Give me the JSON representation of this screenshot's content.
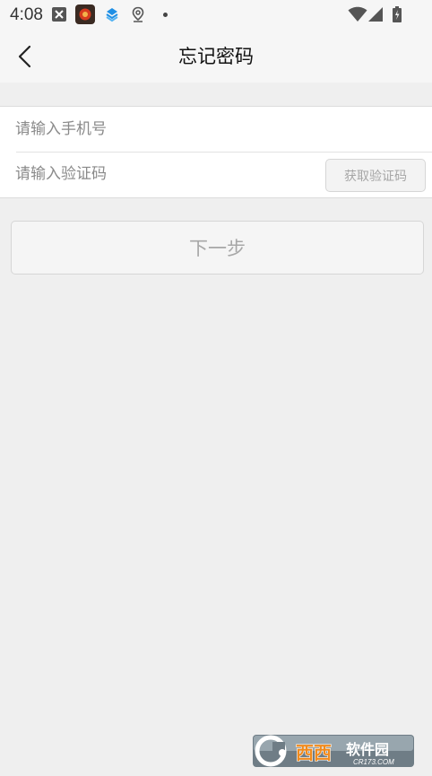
{
  "status_bar": {
    "time": "4:08",
    "icons": [
      "close-box-icon",
      "app-icon-red",
      "layers-icon",
      "location-pin-icon",
      "notification-dot",
      "wifi-icon",
      "cell-signal-icon",
      "battery-icon"
    ]
  },
  "header": {
    "title": "忘记密码",
    "back_icon": "chevron-left-icon"
  },
  "form": {
    "phone_placeholder": "请输入手机号",
    "phone_value": "",
    "code_placeholder": "请输入验证码",
    "code_value": "",
    "get_code_label": "获取验证码"
  },
  "next_label": "下一步",
  "watermark": {
    "brand": "西西软件园",
    "site": "CR173.COM"
  },
  "colors": {
    "page_bg": "#efefef",
    "header_bg": "#f6f6f6",
    "card_bg": "#ffffff",
    "disabled_text": "#a7a7a7",
    "border": "#d6d6d6"
  }
}
